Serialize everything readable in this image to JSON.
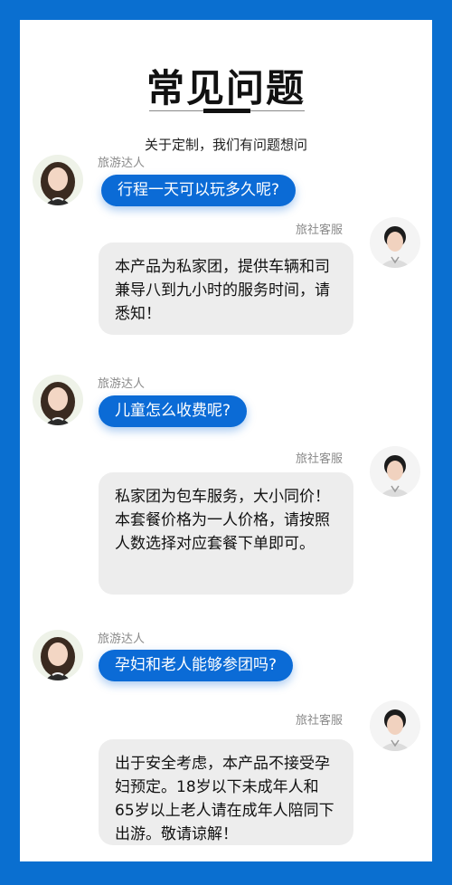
{
  "header": {
    "title": "常见问题",
    "subtitle": "关于定制，我们有问题想问"
  },
  "roles": {
    "traveler": "旅游达人",
    "agency": "旅社客服"
  },
  "qa": [
    {
      "question": "行程一天可以玩多久呢?",
      "answer": "本产品为私家团，提供车辆和司兼导八到九小时的服务时间，请悉知！"
    },
    {
      "question": "儿童怎么收费呢?",
      "answer": "私家团为包车服务，大小同价！本套餐价格为一人价格，请按照人数选择对应套餐下单即可。"
    },
    {
      "question": "孕妇和老人能够参团吗?",
      "answer": "出于安全考虑，本产品不接受孕妇预定。18岁以下未成年人和65岁以上老人请在成年人陪同下出游。敬请谅解！"
    }
  ],
  "colors": {
    "frame": "#0a6fd0",
    "question_bubble": "#0b6bd6",
    "answer_bubble": "#ededed"
  }
}
